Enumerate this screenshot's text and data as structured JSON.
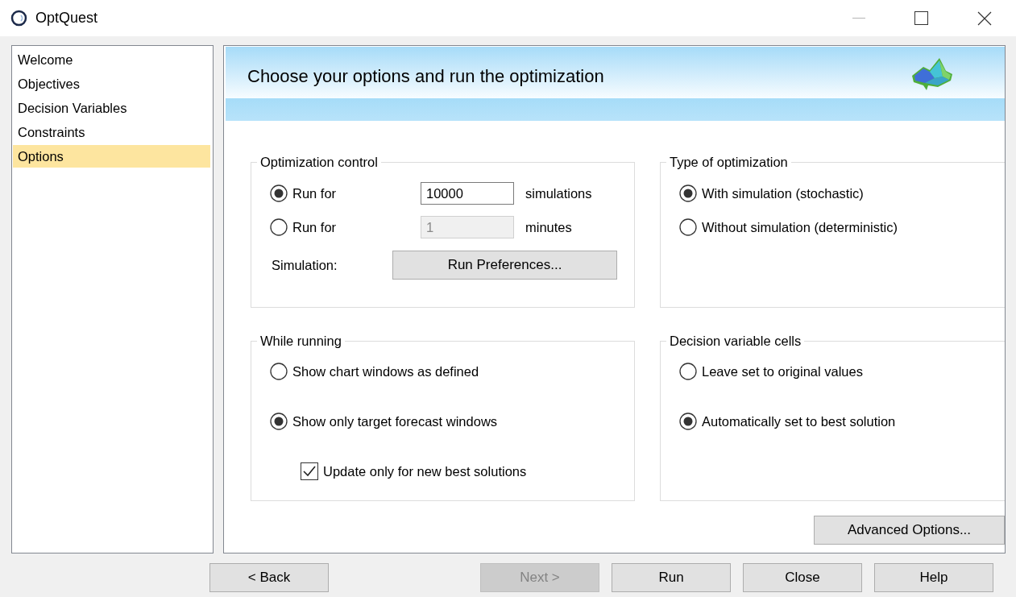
{
  "window": {
    "title": "OptQuest"
  },
  "sidebar": {
    "items": [
      {
        "label": "Welcome",
        "selected": false
      },
      {
        "label": "Objectives",
        "selected": false
      },
      {
        "label": "Decision Variables",
        "selected": false
      },
      {
        "label": "Constraints",
        "selected": false
      },
      {
        "label": "Options",
        "selected": true
      }
    ]
  },
  "header": {
    "title": "Choose your options and run the optimization"
  },
  "panels": [
    {
      "title": "Optimization control",
      "rows": [
        {
          "kind": "radio-field",
          "label": "Run for",
          "selected": true,
          "value": "10000",
          "disabled": false,
          "unit": "simulations"
        },
        {
          "kind": "radio-field",
          "label": "Run for",
          "selected": false,
          "value": "1",
          "disabled": true,
          "unit": "minutes"
        },
        {
          "kind": "button-row",
          "label": "Simulation:",
          "button": "Run Preferences..."
        }
      ]
    },
    {
      "title": "Type of optimization",
      "rows": [
        {
          "kind": "radio",
          "label": "With simulation (stochastic)",
          "selected": true
        },
        {
          "kind": "radio",
          "label": "Without simulation (deterministic)",
          "selected": false
        }
      ]
    },
    {
      "title": "While running",
      "rows": [
        {
          "kind": "radio",
          "label": "Show chart windows as defined",
          "selected": false
        },
        {
          "kind": "radio",
          "label": "Show only target forecast windows",
          "selected": true
        },
        {
          "kind": "checkbox",
          "label": "Update only for new best solutions",
          "checked": true
        }
      ]
    },
    {
      "title": "Decision variable cells",
      "rows": [
        {
          "kind": "radio",
          "label": "Leave set to original values",
          "selected": false
        },
        {
          "kind": "radio",
          "label": "Automatically set to best solution",
          "selected": true
        }
      ]
    }
  ],
  "advanced_button": "Advanced Options...",
  "footer_buttons": [
    {
      "label": "< Back",
      "disabled": false
    },
    {
      "label": "Next >",
      "disabled": true
    },
    {
      "label": "Run",
      "disabled": false
    },
    {
      "label": "Close",
      "disabled": false
    },
    {
      "label": "Help",
      "disabled": false
    }
  ]
}
